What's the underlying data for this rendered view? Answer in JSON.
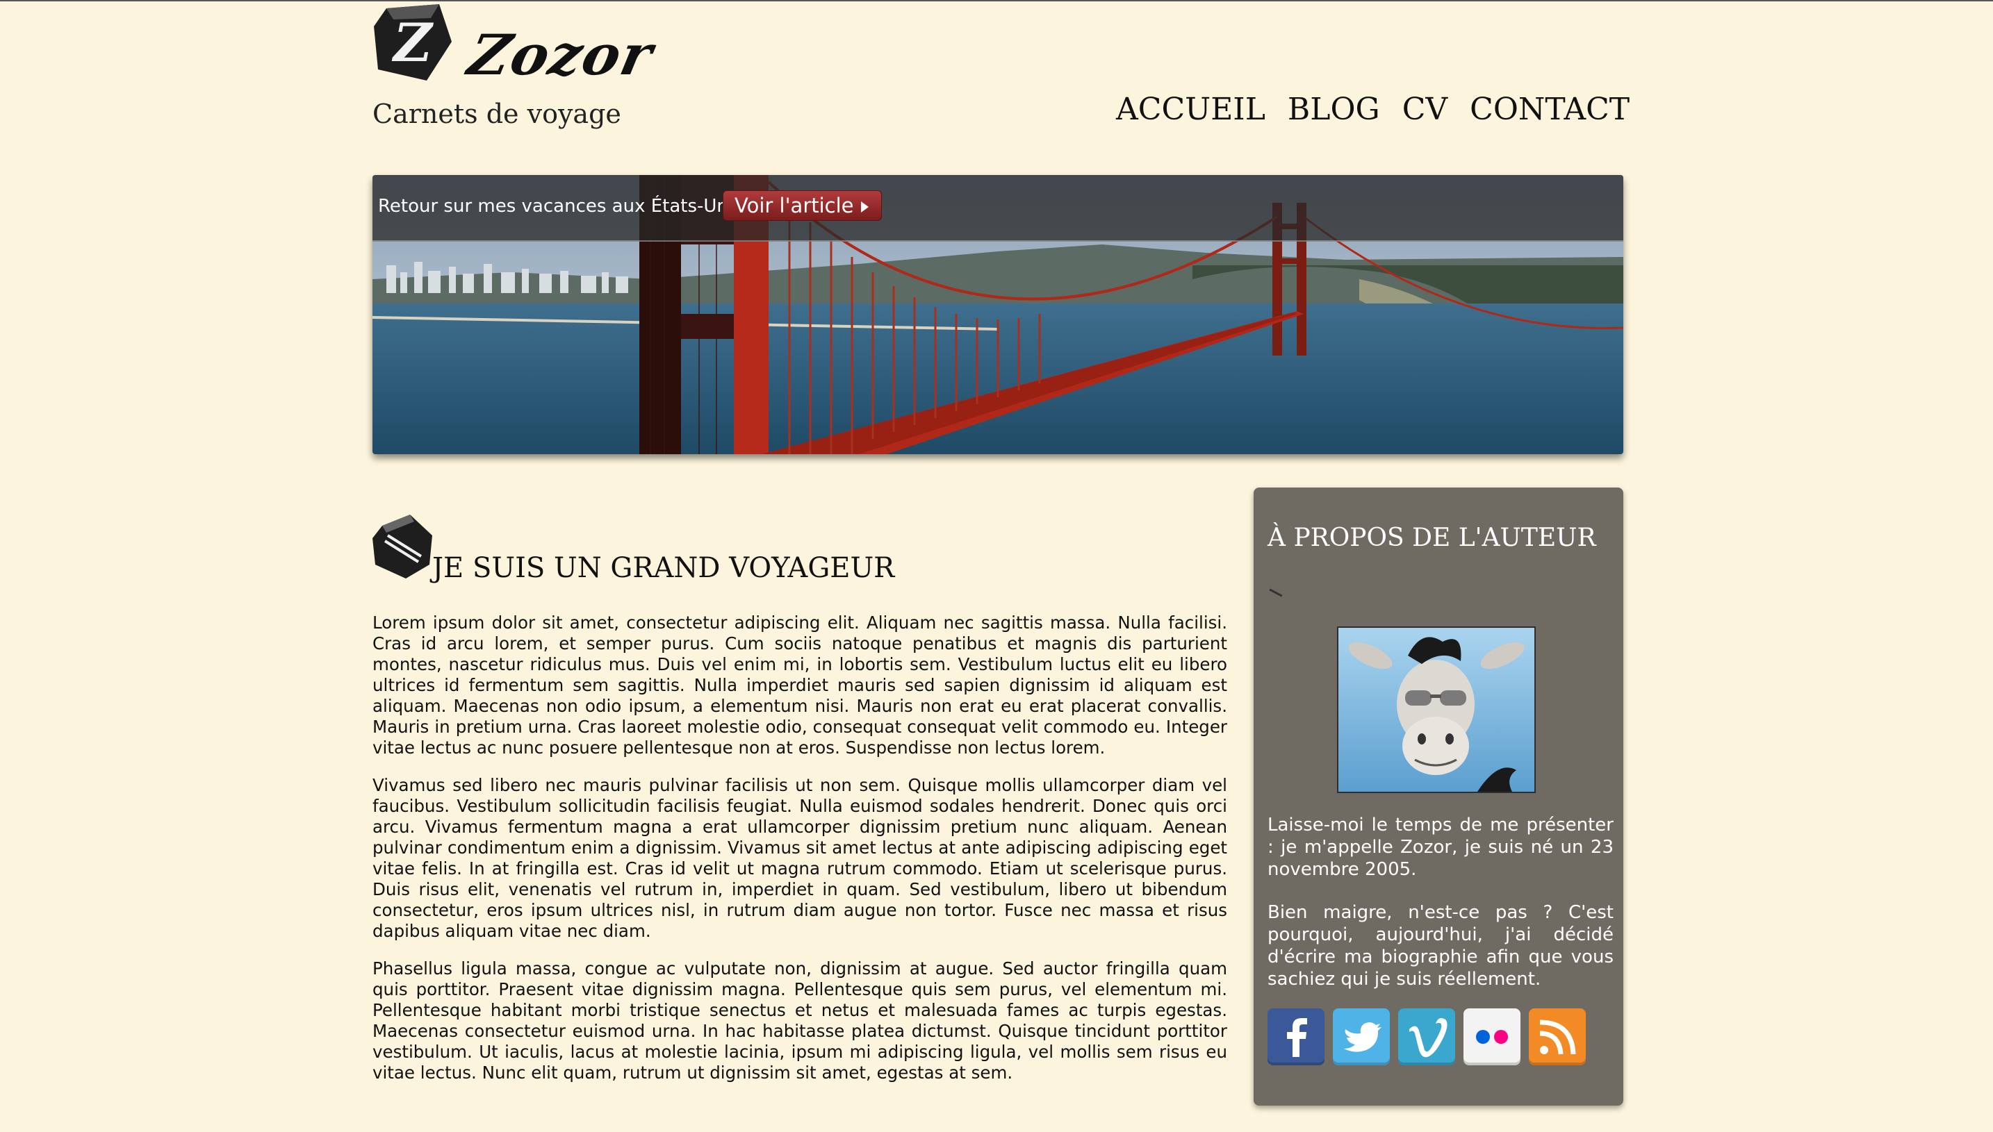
{
  "header": {
    "logo_text": "Zozor",
    "tagline": "Carnets de voyage",
    "nav": [
      "ACCUEIL",
      "BLOG",
      "CV",
      "CONTACT"
    ]
  },
  "banner": {
    "text": "Retour sur mes vacances aux États-Unis...",
    "button_label": "Voir l'article"
  },
  "article": {
    "title": "JE SUIS UN GRAND VOYAGEUR",
    "paragraphs": [
      "Lorem ipsum dolor sit amet, consectetur adipiscing elit. Aliquam nec sagittis massa. Nulla facilisi. Cras id arcu lorem, et semper purus. Cum sociis natoque penatibus et magnis dis parturient montes, nascetur ridiculus mus. Duis vel enim mi, in lobortis sem. Vestibulum luctus elit eu libero ultrices id fermentum sem sagittis. Nulla imperdiet mauris sed sapien dignissim id aliquam est aliquam. Maecenas non odio ipsum, a elementum nisi. Mauris non erat eu erat placerat convallis. Mauris in pretium urna. Cras laoreet molestie odio, consequat consequat velit commodo eu. Integer vitae lectus ac nunc posuere pellentesque non at eros. Suspendisse non lectus lorem.",
      "Vivamus sed libero nec mauris pulvinar facilisis ut non sem. Quisque mollis ullamcorper diam vel faucibus. Vestibulum sollicitudin facilisis feugiat. Nulla euismod sodales hendrerit. Donec quis orci arcu. Vivamus fermentum magna a erat ullamcorper dignissim pretium nunc aliquam. Aenean pulvinar condimentum enim a dignissim. Vivamus sit amet lectus at ante adipiscing adipiscing eget vitae felis. In at fringilla est. Cras id velit ut magna rutrum commodo. Etiam ut scelerisque purus. Duis risus elit, venenatis vel rutrum in, imperdiet in quam. Sed vestibulum, libero ut bibendum consectetur, eros ipsum ultrices nisl, in rutrum diam augue non tortor. Fusce nec massa et risus dapibus aliquam vitae nec diam.",
      "Phasellus ligula massa, congue ac vulputate non, dignissim at augue. Sed auctor fringilla quam quis porttitor. Praesent vitae dignissim magna. Pellentesque quis sem purus, vel elementum mi. Pellentesque habitant morbi tristique senectus et netus et malesuada fames ac turpis egestas. Maecenas consectetur euismod urna. In hac habitasse platea dictumst. Quisque tincidunt porttitor vestibulum. Ut iaculis, lacus at molestie lacinia, ipsum mi adipiscing ligula, vel mollis sem risus eu vitae lectus. Nunc elit quam, rutrum ut dignissim sit amet, egestas at sem."
    ]
  },
  "aside": {
    "title": "À PROPOS DE L'AUTEUR",
    "paragraphs": [
      "Laisse-moi le temps de me présenter : je m'appelle Zozor, je suis né un 23 novembre 2005.",
      "Bien maigre, n'est-ce pas ? C'est pourquoi, aujourd'hui, j'ai décidé d'écrire ma biographie afin que vous sachiez qui je suis réellement."
    ],
    "social": [
      {
        "icon": "facebook-icon",
        "color": "#3b5998"
      },
      {
        "icon": "twitter-icon",
        "color": "#4fb3e8"
      },
      {
        "icon": "vimeo-icon",
        "color": "#3aa7cf"
      },
      {
        "icon": "flickr-icon",
        "color": "#f3f3f3"
      },
      {
        "icon": "rss-icon",
        "color": "#f28a25"
      }
    ]
  },
  "colors": {
    "background": "#fcf4dc",
    "aside_bg": "#6f6a62",
    "button_red": "#9a2a2a"
  }
}
